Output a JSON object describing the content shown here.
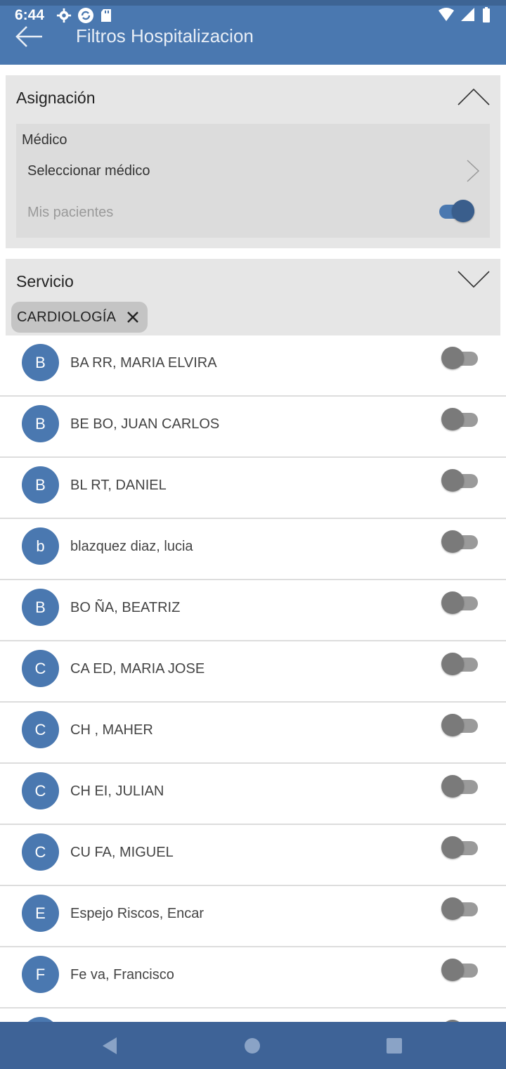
{
  "status_bar": {
    "time": "6:44"
  },
  "app_bar": {
    "title": "Filtros Hospitalizacion"
  },
  "asignacion": {
    "title": "Asignación",
    "medico_label": "Médico",
    "medico_placeholder": "Seleccionar médico",
    "mis_pacientes_label": "Mis pacientes",
    "mis_pacientes_enabled": true
  },
  "servicio": {
    "title": "Servicio",
    "chip_label": "CARDIOLOGÍA"
  },
  "doctors": [
    {
      "initial": "B",
      "name": "BA RR, MARIA ELVIRA",
      "selected": false
    },
    {
      "initial": "B",
      "name": "BE BO, JUAN CARLOS",
      "selected": false
    },
    {
      "initial": "B",
      "name": "BL RT, DANIEL",
      "selected": false
    },
    {
      "initial": "b",
      "name": "blazquez diaz, lucia",
      "selected": false
    },
    {
      "initial": "B",
      "name": "BO ÑA, BEATRIZ",
      "selected": false
    },
    {
      "initial": "C",
      "name": "CA ED, MARIA JOSE",
      "selected": false
    },
    {
      "initial": "C",
      "name": "CH , MAHER",
      "selected": false
    },
    {
      "initial": "C",
      "name": "CH EI, JULIAN",
      "selected": false
    },
    {
      "initial": "C",
      "name": "CU FA, MIGUEL",
      "selected": false
    },
    {
      "initial": "E",
      "name": "Espejo Riscos, Encar",
      "selected": false
    },
    {
      "initial": "F",
      "name": "Fe va, Francisco",
      "selected": false
    }
  ],
  "colors": {
    "primary": "#4a78b0",
    "nav_bar": "#3e6397",
    "panel": "#e6e6e6"
  }
}
